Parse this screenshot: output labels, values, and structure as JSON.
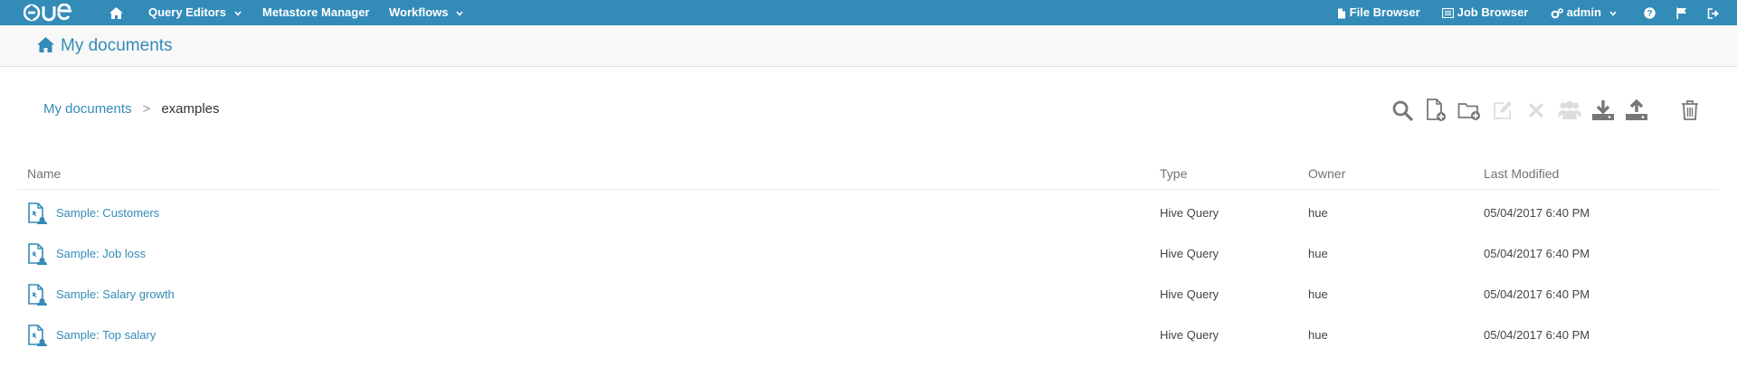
{
  "navbar": {
    "logo": "HUE",
    "items": [
      {
        "label": "Query Editors",
        "icon": "chevron-down-icon"
      },
      {
        "label": "Metastore Manager"
      },
      {
        "label": "Workflows",
        "icon": "chevron-down-icon"
      }
    ],
    "right": [
      {
        "label": "File Browser",
        "icon": "file-icon"
      },
      {
        "label": "Job Browser",
        "icon": "list-icon"
      },
      {
        "label": "admin",
        "icon": "cogs-icon"
      }
    ]
  },
  "page": {
    "title": "My documents"
  },
  "breadcrumb": {
    "root": "My documents",
    "separator": ">",
    "current": "examples"
  },
  "toolbar": [
    "search-icon",
    "new-document-icon",
    "new-folder-icon",
    "edit-icon",
    "delete-icon",
    "share-icon",
    "download-icon",
    "upload-icon",
    "trash-icon"
  ],
  "table": {
    "headers": [
      "Name",
      "Type",
      "Owner",
      "Last Modified"
    ],
    "rows": [
      {
        "name": "Sample: Customers",
        "type": "Hive Query",
        "owner": "hue",
        "modified": "05/04/2017 6:40 PM"
      },
      {
        "name": "Sample: Job loss",
        "type": "Hive Query",
        "owner": "hue",
        "modified": "05/04/2017 6:40 PM"
      },
      {
        "name": "Sample: Salary growth",
        "type": "Hive Query",
        "owner": "hue",
        "modified": "05/04/2017 6:40 PM"
      },
      {
        "name": "Sample: Top salary",
        "type": "Hive Query",
        "owner": "hue",
        "modified": "05/04/2017 6:40 PM"
      }
    ]
  },
  "colors": {
    "navbar": "#338bb8",
    "link": "#338bb8",
    "header_bg": "#f8f8f8"
  }
}
